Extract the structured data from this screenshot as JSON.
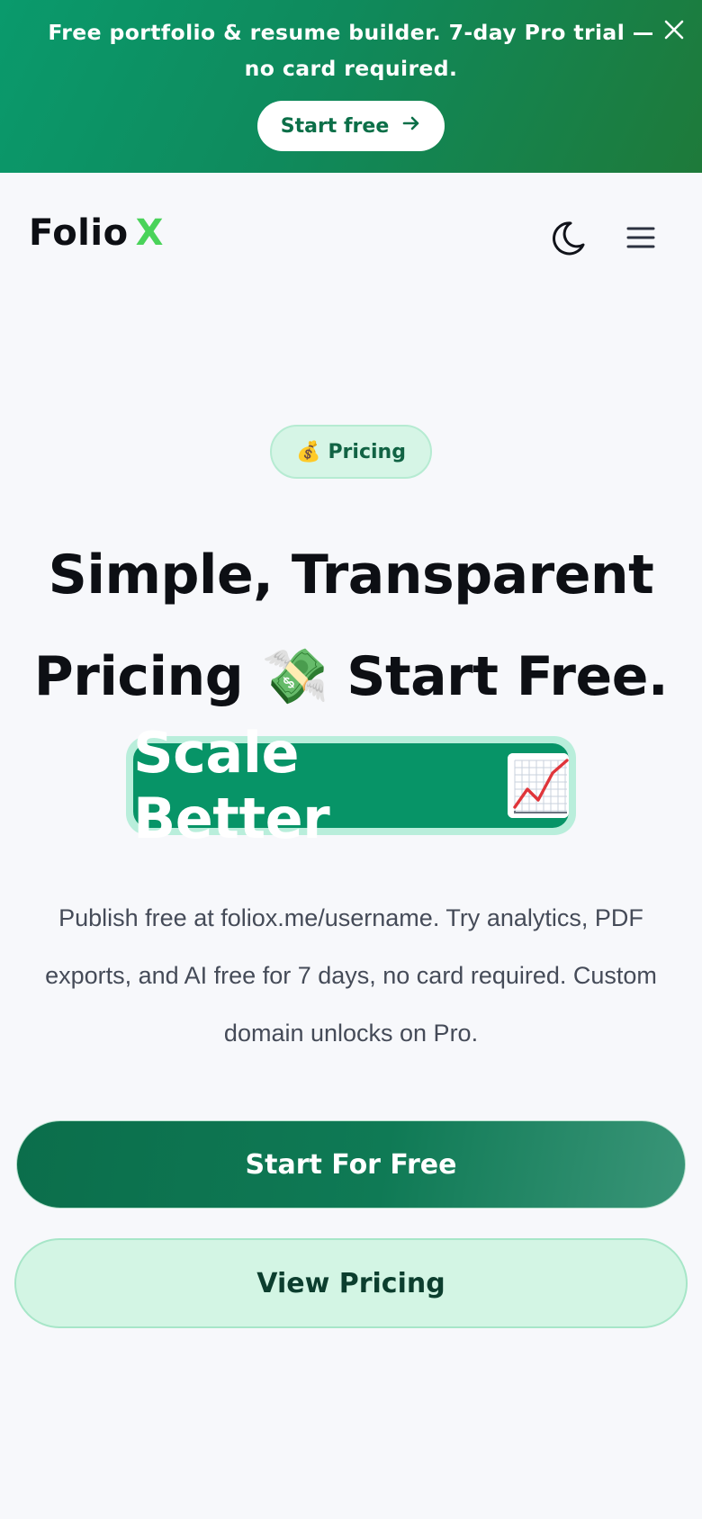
{
  "banner": {
    "text_start": "Free portfolio & resume builder.",
    "text_bold": "7-day Pro trial",
    "text_end": "— no card required.",
    "cta_label": "Start free",
    "cta_icon": "arrow-right-icon",
    "close_icon": "close-icon",
    "colors": {
      "gradient_start": "#0a9a6c",
      "gradient_end": "#1e7a3a"
    }
  },
  "header": {
    "logo_word": "Folio",
    "logo_mark": "X",
    "logo_mark_color": "#4ad35a",
    "theme_icon": "moon-icon",
    "menu_icon": "hamburger-menu-icon"
  },
  "hero": {
    "pill_emoji": "💰",
    "pill_label": "Pricing",
    "headline_line1": "Simple, Transparent",
    "headline_line2_start": "Pricing",
    "headline_emoji": "💸",
    "headline_line2_end": "Start Free.",
    "highlight_text": "Scale Better",
    "highlight_emoji": "chart-increasing-icon",
    "highlight_color": "#079467",
    "description": "Publish free at foliox.me/username. Try analytics, PDF exports, and AI free for 7 days, no card required. Custom domain unlocks on Pro."
  },
  "actions": {
    "primary_label": "Start For Free",
    "secondary_label": "View Pricing"
  }
}
